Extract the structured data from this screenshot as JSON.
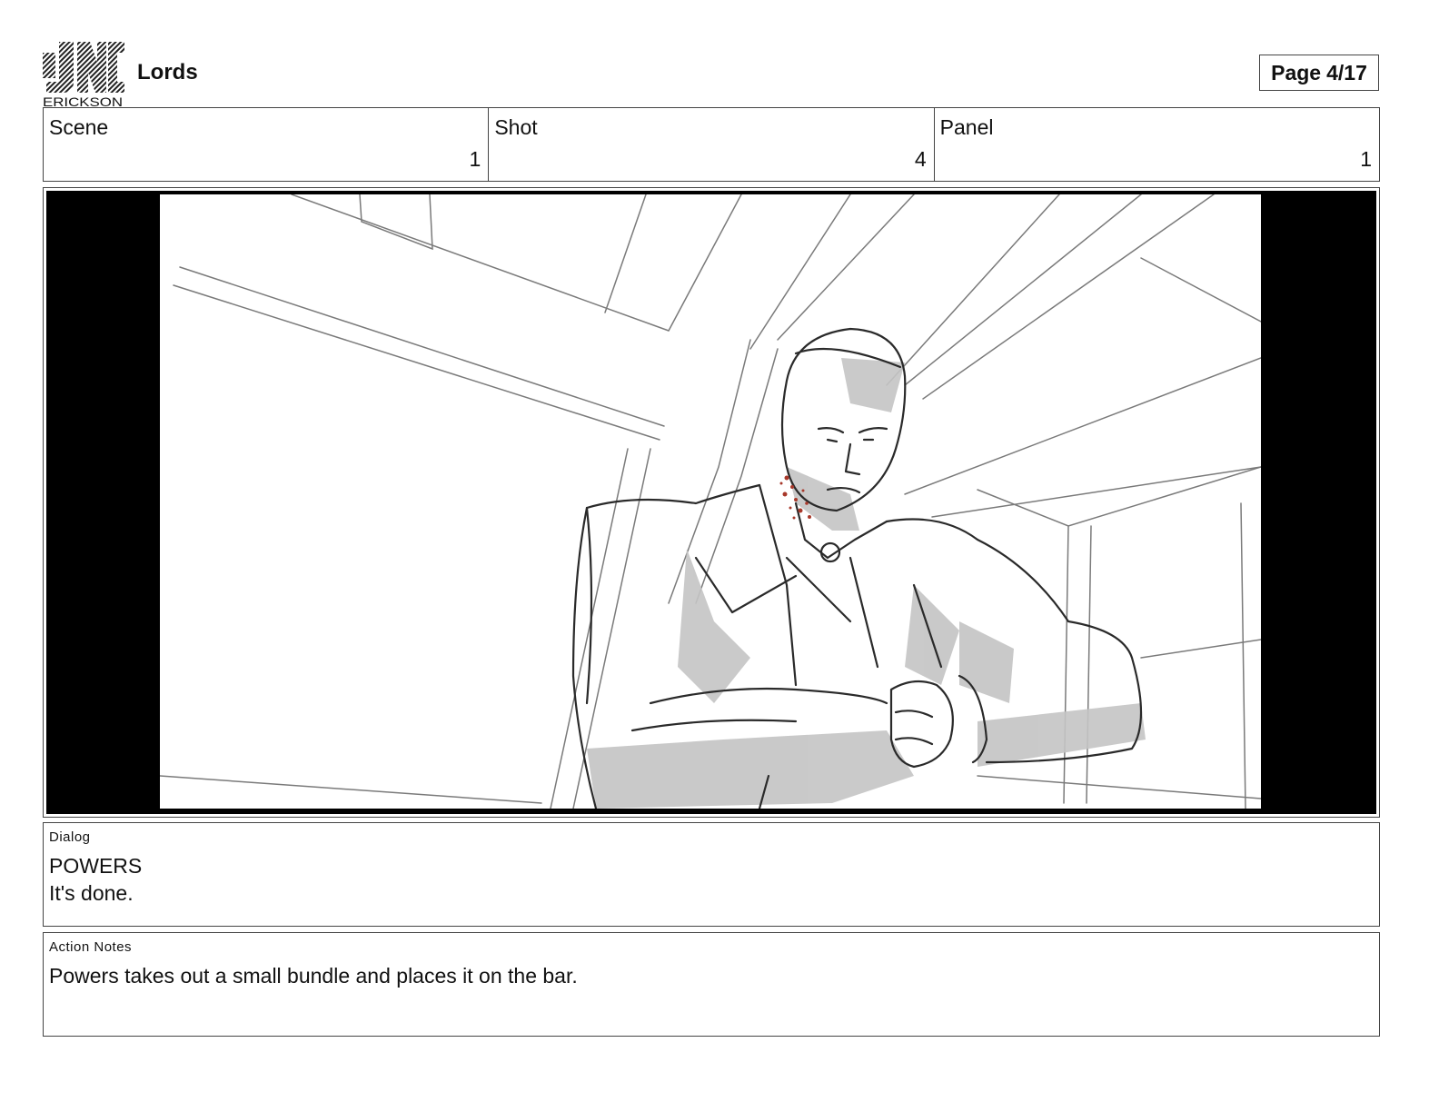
{
  "header": {
    "logo_text": "ERICKSON",
    "title": "Lords",
    "page_label": "Page",
    "page_number": "4/17"
  },
  "meta": {
    "scene_label": "Scene",
    "scene_value": "1",
    "shot_label": "Shot",
    "shot_value": "4",
    "panel_label": "Panel",
    "panel_value": "1"
  },
  "frame": {
    "letterbox_color": "#000000",
    "sketch_shade": "#c4c4c4",
    "blood_color": "#a8382a"
  },
  "dialog": {
    "label": "Dialog",
    "character": "POWERS",
    "line": "It's done."
  },
  "notes": {
    "label": "Action Notes",
    "text": "Powers takes out a small bundle and places it on the bar."
  }
}
